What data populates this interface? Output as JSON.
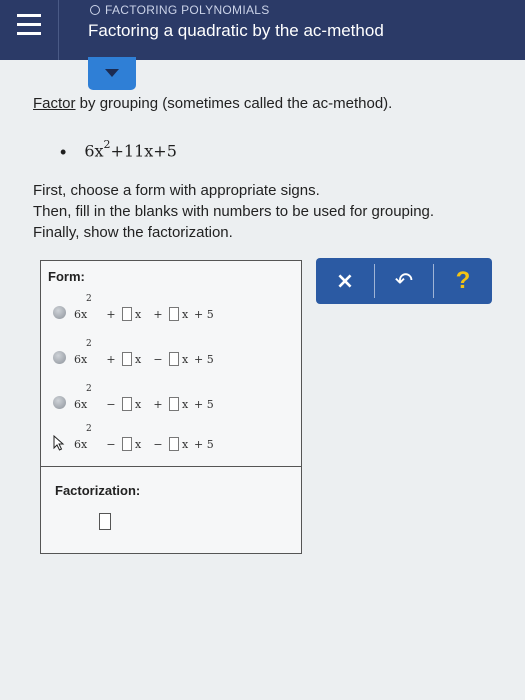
{
  "header": {
    "topic": "FACTORING POLYNOMIALS",
    "title": "Factoring a quadratic by the ac-method"
  },
  "instruction": {
    "keyword": "Factor",
    "rest": " by grouping (sometimes called the ac-method)."
  },
  "problem": {
    "bullet": "•",
    "expression": {
      "coef": "6x",
      "exp": "2",
      "rest": "+11x+5"
    }
  },
  "steps": [
    "First, choose a form with appropriate signs.",
    "Then, fill in the blanks with numbers to be used for grouping.",
    "Finally, show the factorization."
  ],
  "form": {
    "label": "Form:",
    "options": [
      {
        "lead": "6x",
        "exp": "2",
        "s1": "+",
        "s2": "+",
        "v1": "x",
        "v2": "x",
        "tail": "+ 5"
      },
      {
        "lead": "6x",
        "exp": "2",
        "s1": "+",
        "s2": "−",
        "v1": "x",
        "v2": "x",
        "tail": "+ 5"
      },
      {
        "lead": "6x",
        "exp": "2",
        "s1": "−",
        "s2": "+",
        "v1": "x",
        "v2": "x",
        "tail": "+ 5"
      },
      {
        "lead": "6x",
        "exp": "2",
        "s1": "−",
        "s2": "−",
        "v1": "x",
        "v2": "x",
        "tail": "+ 5"
      }
    ]
  },
  "factorization": {
    "label": "Factorization:"
  },
  "buttons": {
    "clear": "×",
    "undo": "↶",
    "help": "?"
  }
}
